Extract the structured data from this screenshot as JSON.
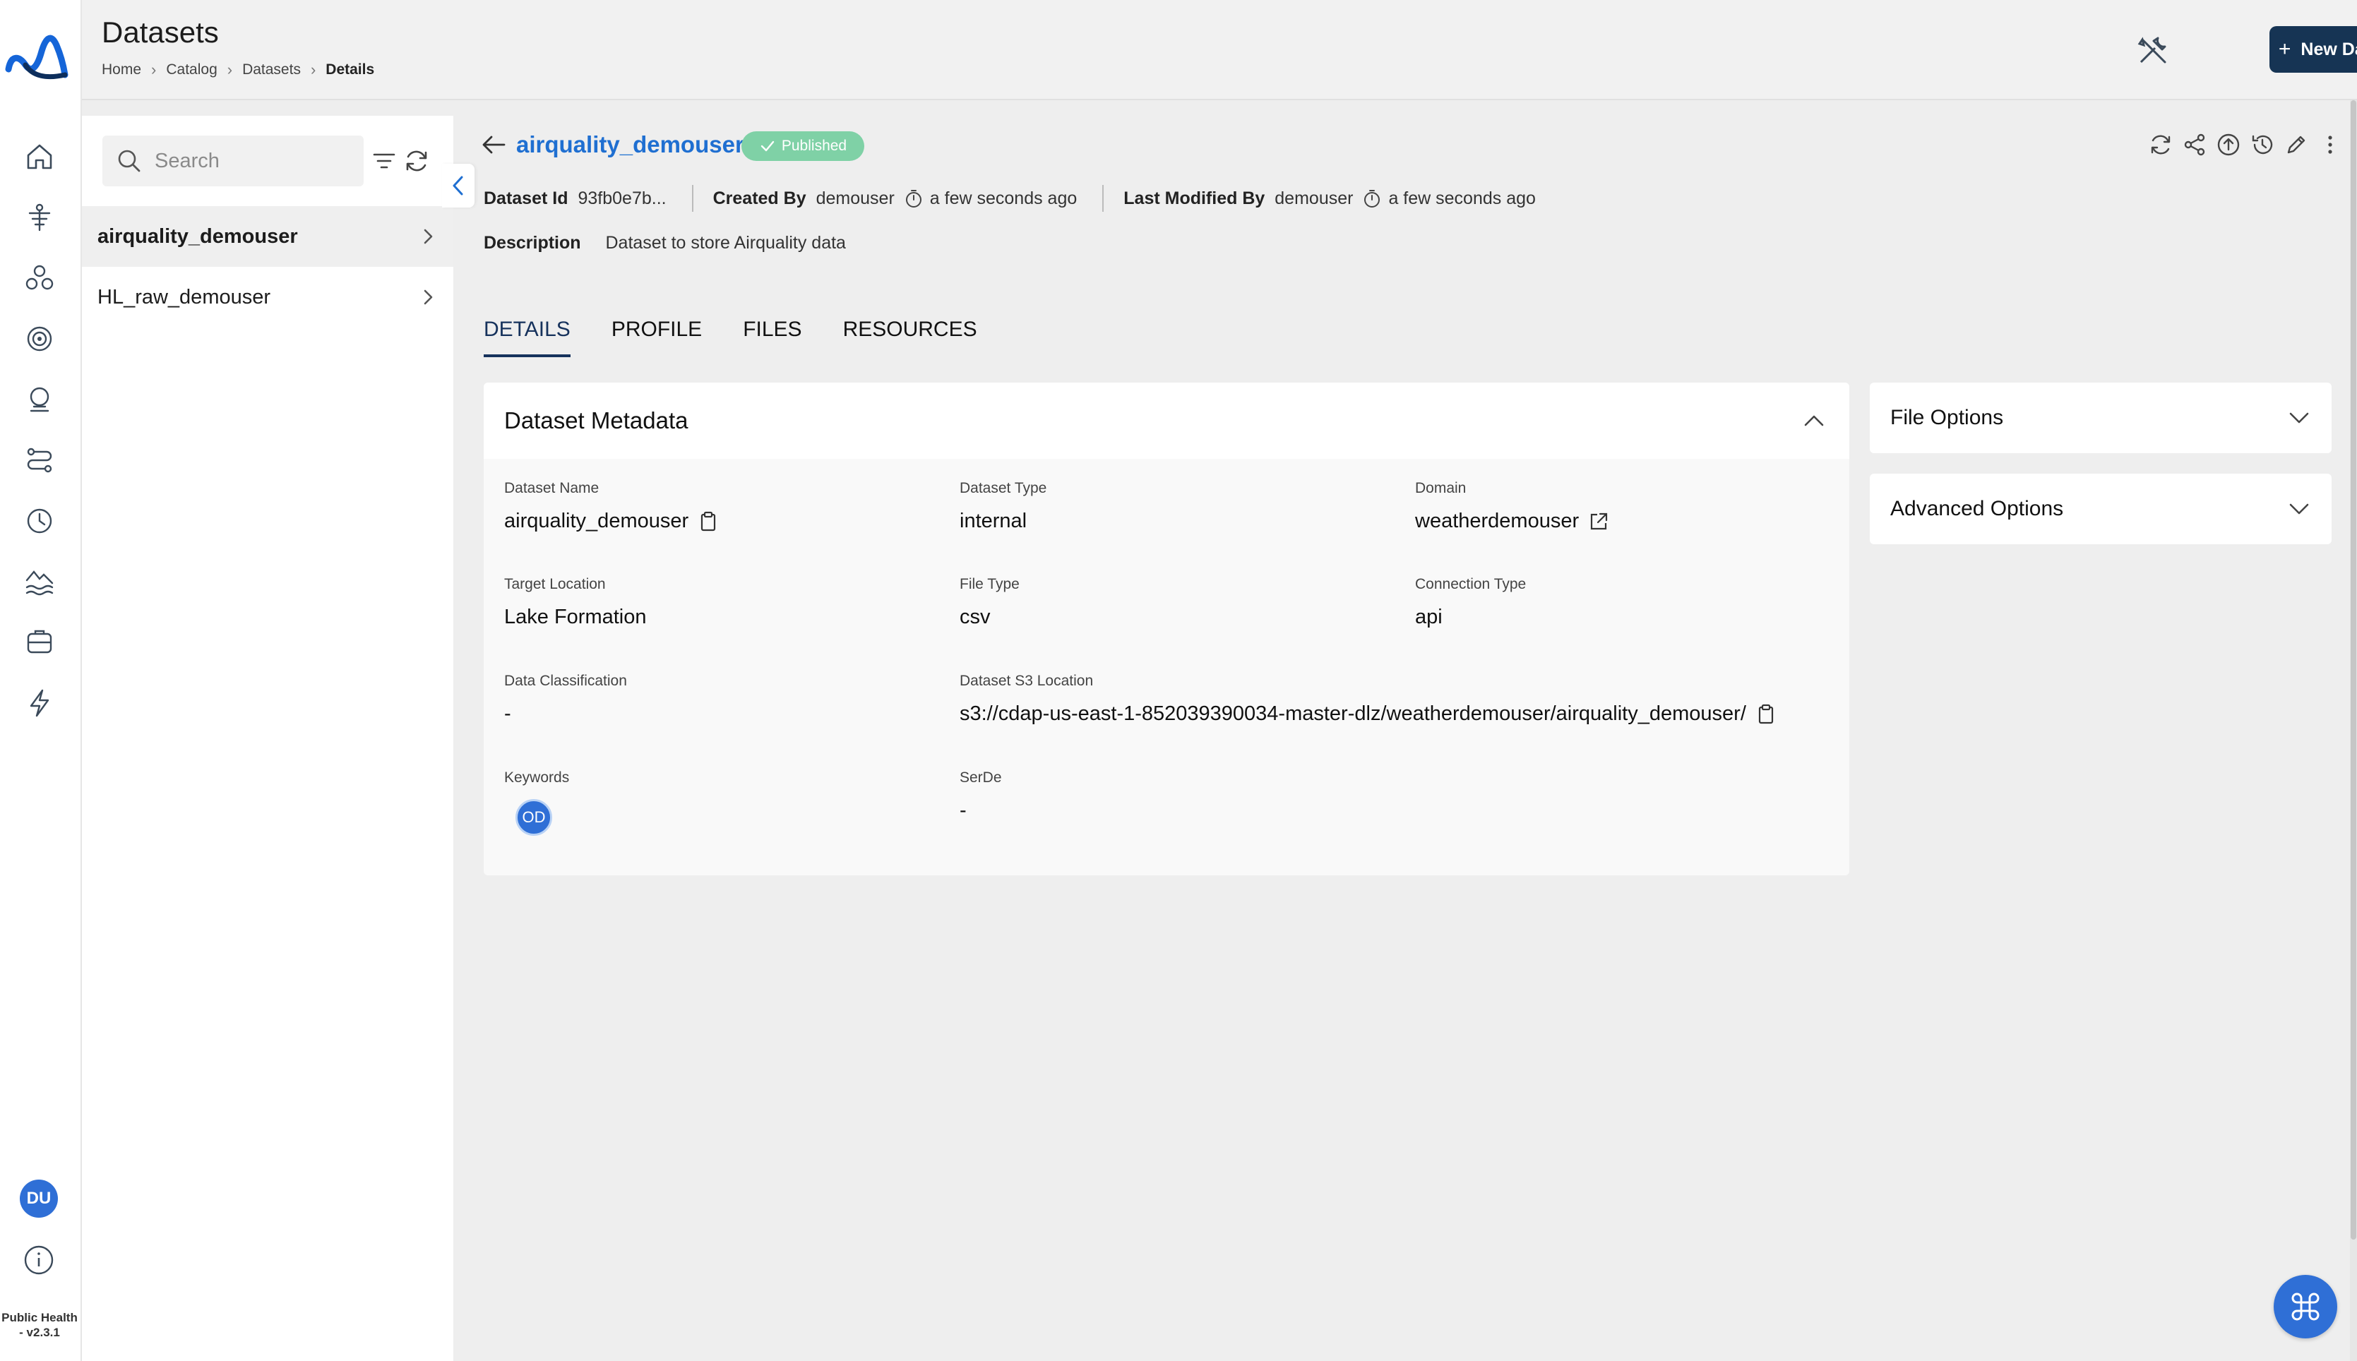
{
  "app": {
    "version_label": "Public Health - v2.3.1",
    "user_initials": "DU"
  },
  "header": {
    "title": "Datasets",
    "breadcrumb": [
      "Home",
      "Catalog",
      "Datasets",
      "Details"
    ],
    "new_button": "New Dataset"
  },
  "sidebar_nav": [
    {
      "name": "home-icon"
    },
    {
      "name": "ingestion-icon"
    },
    {
      "name": "catalog-icon"
    },
    {
      "name": "target-icon"
    },
    {
      "name": "monitor-icon"
    },
    {
      "name": "pipeline-icon"
    },
    {
      "name": "clock-icon"
    },
    {
      "name": "lake-icon"
    },
    {
      "name": "storage-icon"
    },
    {
      "name": "bolt-icon"
    }
  ],
  "list": {
    "search_placeholder": "Search",
    "items": [
      {
        "label": "airquality_demouser",
        "active": true
      },
      {
        "label": "HL_raw_demouser",
        "active": false
      }
    ]
  },
  "dataset": {
    "name": "airquality_demouser",
    "status": "Published",
    "id_label": "Dataset Id",
    "id_value": "93fb0e7b...",
    "created_by_label": "Created By",
    "created_by": "demouser",
    "created_time": "a few seconds ago",
    "modified_by_label": "Last Modified By",
    "modified_by": "demouser",
    "modified_time": "a few seconds ago",
    "description_label": "Description",
    "description": "Dataset to store Airquality data"
  },
  "tabs": [
    "DETAILS",
    "PROFILE",
    "FILES",
    "RESOURCES"
  ],
  "metadata": {
    "title": "Dataset Metadata",
    "dataset_name_label": "Dataset Name",
    "dataset_name": "airquality_demouser",
    "dataset_type_label": "Dataset Type",
    "dataset_type": "internal",
    "domain_label": "Domain",
    "domain": "weatherdemouser",
    "target_location_label": "Target Location",
    "target_location": "Lake Formation",
    "file_type_label": "File Type",
    "file_type": "csv",
    "connection_type_label": "Connection Type",
    "connection_type": "api",
    "data_classification_label": "Data Classification",
    "data_classification": "-",
    "s3_location_label": "Dataset S3 Location",
    "s3_location": "s3://cdap-us-east-1-852039390034-master-dlz/weatherdemouser/airquality_demouser/",
    "keywords_label": "Keywords",
    "keyword_avatar": "OD",
    "serde_label": "SerDe",
    "serde": "-"
  },
  "side_panels": {
    "file_options": "File Options",
    "advanced_options": "Advanced Options"
  },
  "colors": {
    "accent": "#1f6fd1",
    "primary_button": "#163454",
    "published": "#7fd1a6",
    "avatar": "#2f6fd6"
  }
}
